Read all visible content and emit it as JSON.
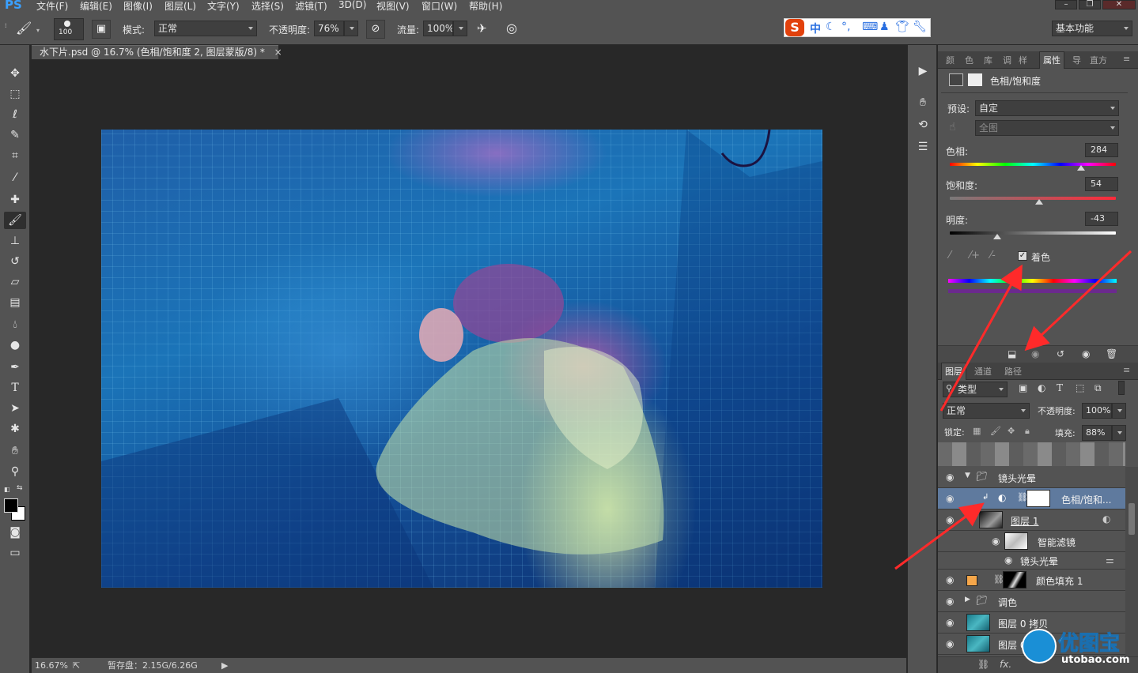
{
  "menubar": {
    "logo": "PS",
    "items": [
      "文件(F)",
      "编辑(E)",
      "图像(I)",
      "图层(L)",
      "文字(Y)",
      "选择(S)",
      "滤镜(T)",
      "3D(D)",
      "视图(V)",
      "窗口(W)",
      "帮助(H)"
    ]
  },
  "options": {
    "brush_size": "100",
    "mode_label": "模式:",
    "mode_value": "正常",
    "opacity_label": "不透明度:",
    "opacity_value": "76%",
    "flow_label": "流量:",
    "flow_value": "100%",
    "workspace": "基本功能"
  },
  "ime": {
    "logo": "S",
    "lang": "中"
  },
  "document": {
    "tab_title": "水下片.psd @ 16.7% (色相/饱和度 2, 图层蒙版/8) *",
    "close": "×"
  },
  "status": {
    "zoom": "16.67%",
    "scratch": "暂存盘：2.15G/6.26G"
  },
  "properties": {
    "tabs": [
      "颜",
      "色",
      "库",
      "调",
      "样",
      "属性",
      "导",
      "直方"
    ],
    "title": "色相/饱和度",
    "preset_label": "预设:",
    "preset_value": "自定",
    "channel_value": "全图",
    "hue_label": "色相:",
    "hue_value": "284",
    "sat_label": "饱和度:",
    "sat_value": "54",
    "light_label": "明度:",
    "light_value": "-43",
    "colorize_label": "着色",
    "colorize_checked": true,
    "hue": 284,
    "saturation": 54,
    "lightness": -43
  },
  "layers": {
    "tabs": [
      "图层",
      "通道",
      "路径"
    ],
    "filter_kind": "类型",
    "blend_mode": "正常",
    "opacity_label": "不透明度:",
    "opacity_value": "100%",
    "lock_label": "锁定:",
    "fill_label": "填充:",
    "fill_value": "88%",
    "rows": [
      {
        "name": "镜头光晕"
      },
      {
        "name": "色相/饱和..."
      },
      {
        "name": "图层 1"
      },
      {
        "name": "智能滤镜"
      },
      {
        "name": "镜头光晕"
      },
      {
        "name": "颜色填充 1"
      },
      {
        "name": "调色"
      },
      {
        "name": "图层 0 拷贝"
      },
      {
        "name": "图层 0"
      }
    ]
  },
  "watermark": {
    "text": "优图宝",
    "domain": "utobao.com"
  },
  "colors": {
    "accent_red": "#ff2a2a",
    "selected_layer": "#5f7a9e",
    "panel": "#535353",
    "fill_swatch": "#f5a64a"
  }
}
